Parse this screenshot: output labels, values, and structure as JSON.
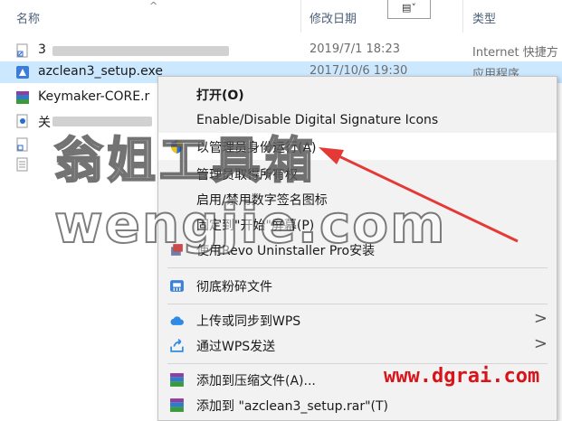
{
  "header": {
    "name": "名称",
    "modified": "修改日期",
    "type": "类型",
    "sort_arrow": "^",
    "view_glyph": "▤˅"
  },
  "files": [
    {
      "name": "3",
      "date": "2019/7/1 18:23",
      "type": "Internet 快捷方",
      "icon": "shortcut-icon"
    },
    {
      "name": "azclean3_setup.exe",
      "date": "2017/10/6 19:30",
      "type": "应用程序",
      "icon": "exe-icon",
      "selected": true
    },
    {
      "name": "Keymaker-CORE.r",
      "date": "",
      "type": "",
      "icon": "rar-icon"
    },
    {
      "name": "关",
      "date": "",
      "type": "",
      "icon": "doc-icon"
    },
    {
      "name": "",
      "date": "",
      "type": "",
      "icon": "shortcut-icon"
    },
    {
      "name": "",
      "date": "",
      "type": "",
      "icon": "text-file-icon"
    }
  ],
  "menu": {
    "open": "打开(O)",
    "digital_sig": "Enable/Disable Digital Signature Icons",
    "run_as_admin": "以管理员身份运行(A)",
    "take_ownership": "管理员取得所有权",
    "toggle_sig": "启用/禁用数字签名图标",
    "pin_start": "固定到\"开始\"屏幕(P)",
    "revo": "使用Revo Uninstaller Pro安装",
    "shred": "彻底粉碎文件",
    "wps_upload": "上传或同步到WPS",
    "wps_send": "通过WPS发送",
    "add_archive": "添加到压缩文件(A)...",
    "add_rar": "添加到 \"azclean3_setup.rar\"(T)",
    "chevron": ">"
  },
  "watermarks": {
    "cn": "翁姐工具箱",
    "en": "wengjie.com",
    "url": "www.dgrai.com"
  },
  "colors": {
    "selection": "#cce8ff",
    "menu_bg": "#f2f2f2",
    "arrow": "#e53935",
    "url": "#d8141a"
  }
}
